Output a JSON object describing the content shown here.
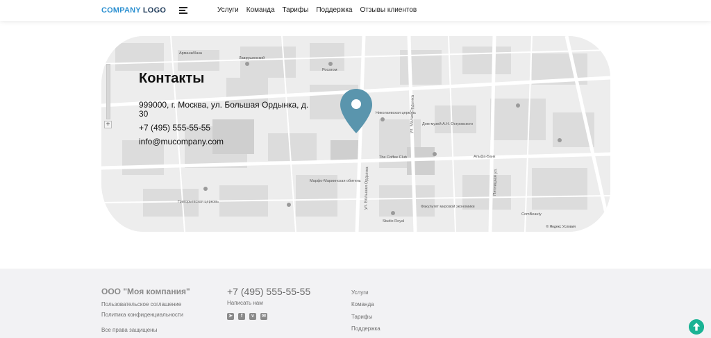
{
  "header": {
    "logo_part1": "COMPANY",
    "logo_part2": "LOGO",
    "nav": [
      "Услуги",
      "Команда",
      "Тарифы",
      "Поддержка",
      "Отзывы клиентов"
    ]
  },
  "contacts": {
    "title": "Контакты",
    "address": "999000, г. Москва, ул. Большая Ордынка, д. 30",
    "phone": "+7 (495) 555-55-55",
    "email": "info@mucompany.com"
  },
  "map": {
    "labels": [
      "Лаврушинский",
      "Росатом",
      "Армани/Каза",
      "Николаевская церковь",
      "Дом-музей А.Н. Островского",
      "The Coffee Club",
      "Марфо-Мариинская обитель",
      "Факультет мировой экономики",
      "Studio Royal",
      "Григорьевская церковь",
      "ул. Большая Ордынка",
      "ул. Малая Ордынка",
      "Пятницкая ул.",
      "Альфа-Банк",
      "ComBeauty"
    ],
    "copyright": "© Яндекс  Условия"
  },
  "footer": {
    "company": "ООО \"Моя компания\"",
    "agreement": "Пользовательское соглашение",
    "privacy": "Политика конфиденциальности",
    "rights": "Все права защищены",
    "phone": "+7 (495) 555-55-55",
    "write": "Написать нам",
    "links": [
      "Услуги",
      "Команда",
      "Тарифы",
      "Поддержка"
    ],
    "socials": [
      "telegram-icon",
      "facebook-icon",
      "vk-icon",
      "chat-icon"
    ]
  },
  "colors": {
    "logo_accent": "#2a8fd0",
    "logo_dark": "#1f3b5a",
    "pin": "#5a95ad",
    "scroll_up": "#1ab394",
    "footer_bg": "#f2f2f4"
  }
}
